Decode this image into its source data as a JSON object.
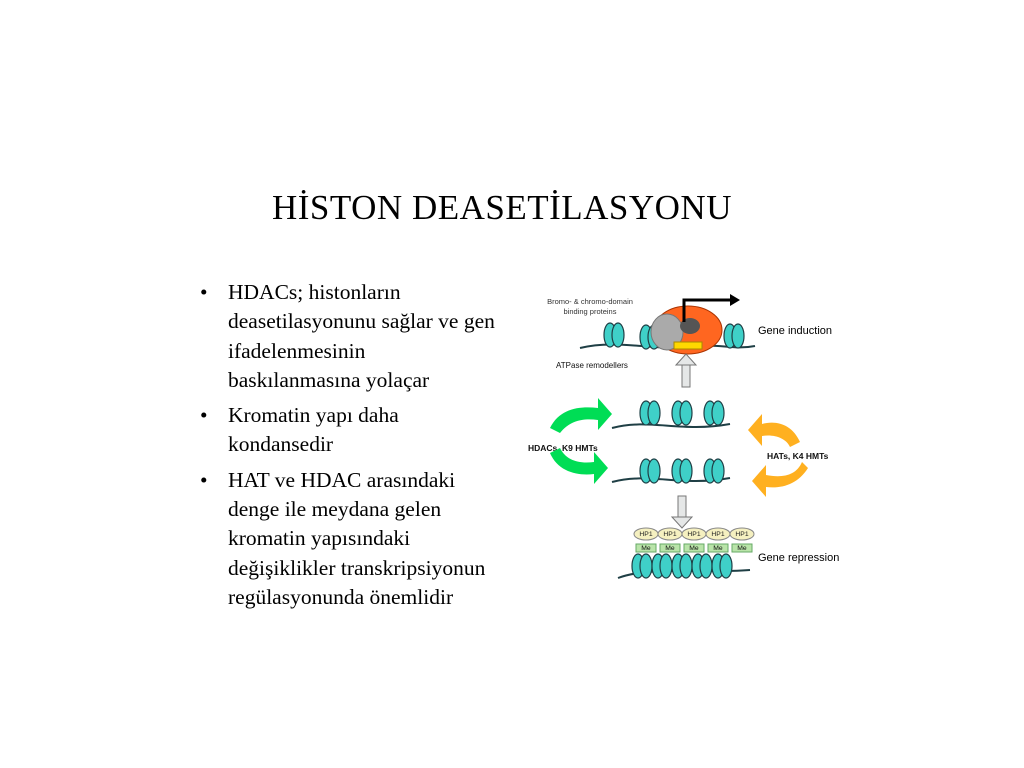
{
  "slide": {
    "title": "HİSTON DEASETİLASYONU",
    "bullets": [
      "HDACs; histonların deasetilasyonunu sağlar ve gen ifadelenmesinin baskılanmasına yolaçar",
      "Kromatin yapı daha kondansedir",
      "HAT ve HDAC arasındaki denge ile meydana gelen kromatin yapısındaki değişiklikler transkripsiyonun regülasyonunda önemlidir"
    ],
    "diagram": {
      "labels": {
        "bromo": "Bromo- & chromo-domain",
        "binding": "binding proteins",
        "gene_induction": "Gene induction",
        "atpase": "ATPase remodellers",
        "hdacs": "HDACs, K9 HMTs",
        "hats": "HATs, K4 HMTs",
        "gene_repression": "Gene repression",
        "hp1": "HP1",
        "me": "Me"
      }
    }
  }
}
